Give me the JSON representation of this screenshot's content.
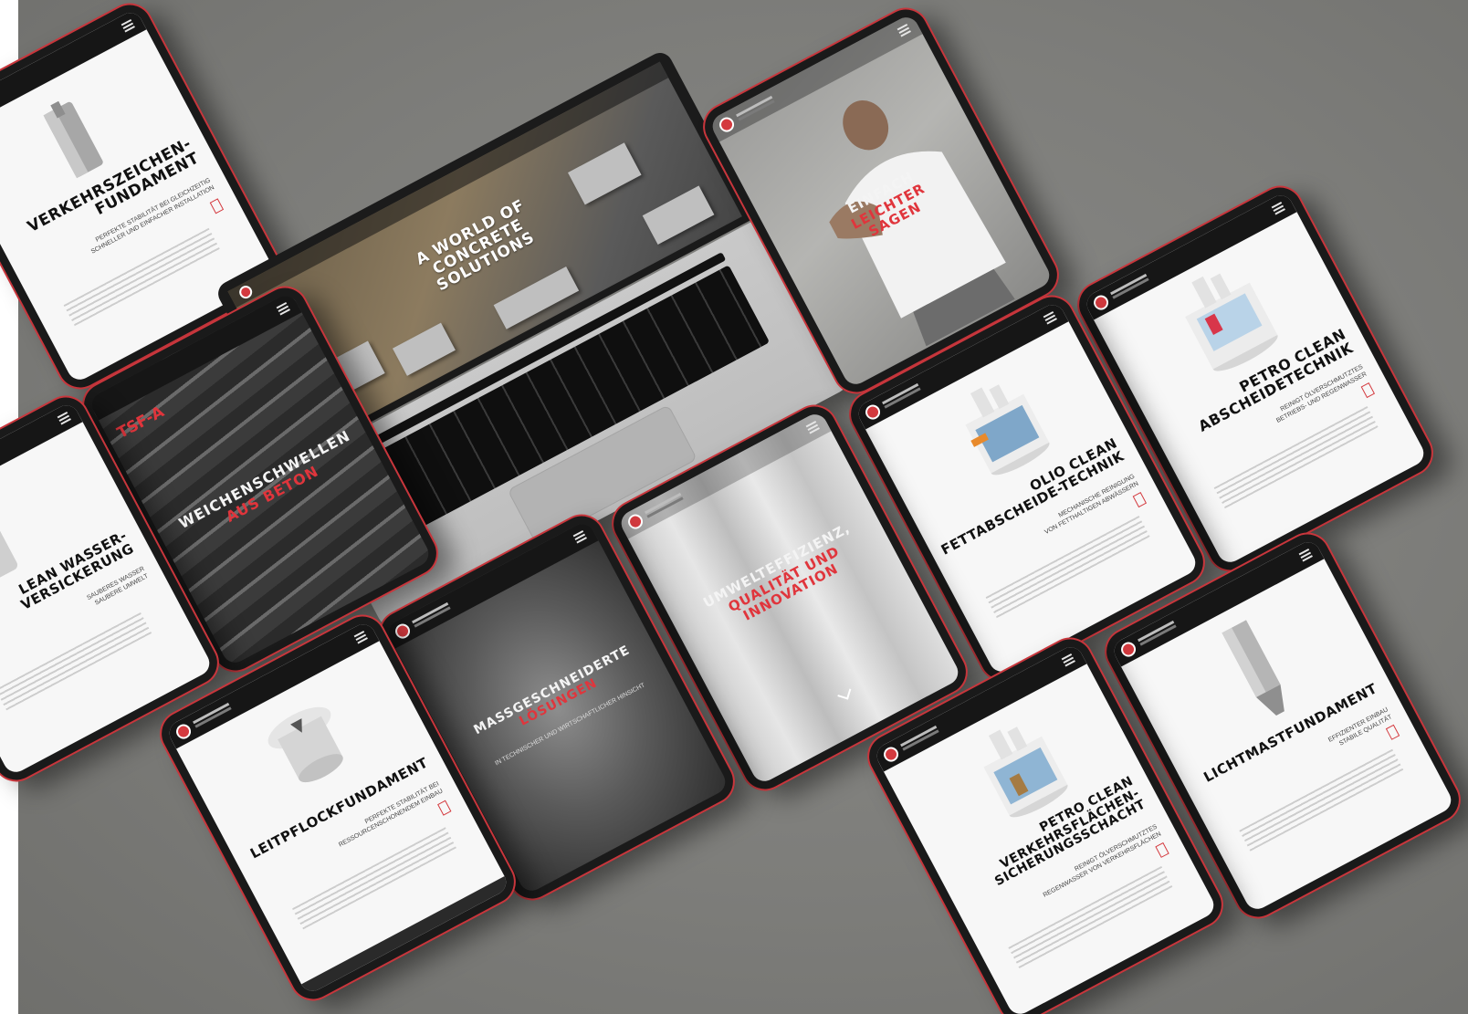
{
  "scene": {
    "background_color": "#7d7d7a",
    "accent_color": "#d43a3f"
  },
  "laptop": {
    "hero_text": "A WORLD OF CONCRETE SOLUTIONS"
  },
  "tablets": {
    "verkehrszeichen": {
      "title": "VERKEHRSZEICHEN-\nFUNDAMENT",
      "subtitle": "PERFEKTE STABILITÄT BEI GLEICHZEITIG\nSCHNELLER UND EINFACHER INSTALLATION"
    },
    "einfach": {
      "hero_line1": "EINFACH",
      "hero_line2": "LEICHTER",
      "hero_line3": "SAGEN"
    },
    "petro_clean_abscheide": {
      "title": "PETRO CLEAN\nABSCHEIDETECHNIK",
      "subtitle": "REINIGT ÖLVERSCHMUTZTES\nBETRIEBS- UND REGENWASSER"
    },
    "tsf_a": {
      "badge": "TSF-A",
      "hero_line1": "WEICHENSCHWELLEN",
      "hero_line2": "AUS BETON"
    },
    "wasser_versickerung": {
      "title": "LEAN WASSER-\nVERSICKERUNG",
      "subtitle": "SAUBERES WASSER\nSAUBERE UMWELT"
    },
    "olio_clean": {
      "title": "OLIO CLEAN\nFETTABSCHEIDE-TECHNIK",
      "subtitle": "MECHANISCHE REINIGUNG\nVON FETTHALTIGEN ABWÄSSERN"
    },
    "umwelteffizienz": {
      "hero_line1": "UMWELTEFFIZIENZ,",
      "hero_line2": "QUALITÄT UND",
      "hero_line3": "INNOVATION"
    },
    "massgeschneiderte": {
      "hero_line1": "MASSGESCHNEIDERTE",
      "hero_line2": "LÖSUNGEN",
      "subtitle": "IN TECHNISCHER UND WIRTSCHAFTLICHER HINSICHT"
    },
    "leitpflock": {
      "title": "LEITPFLOCKFUNDAMENT",
      "subtitle": "PERFEKTE STABILITÄT BEI\nRESSOURCENSCHONENDEM EINBAU"
    },
    "lichtmast": {
      "title": "LICHTMASTFUNDAMENT",
      "subtitle": "EFFIZIENTER EINBAU\nSTABILE QUALITÄT"
    },
    "petro_clean_verkehr": {
      "title": "PETRO CLEAN\nVERKEHRSFLÄCHEN-\nSICHERUNGSSCHACHT",
      "subtitle": "REINIGT ÖLVERSCHMUTZTES\nREGENWASSER VON VERKEHRSFLÄCHEN"
    }
  }
}
